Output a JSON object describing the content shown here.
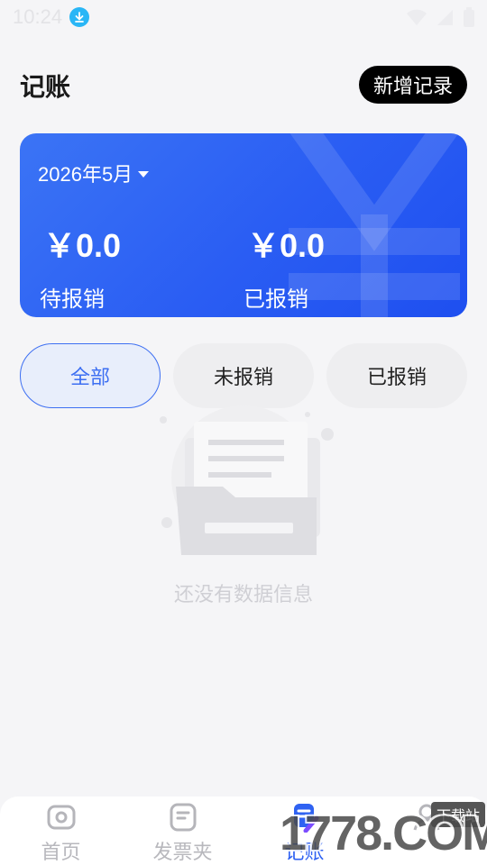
{
  "status_bar": {
    "time": "10:24"
  },
  "header": {
    "title": "记账",
    "add_button": "新增记录"
  },
  "summary": {
    "month": "2026年5月",
    "pending_amount": "￥0.0",
    "done_amount": "￥0.0",
    "pending_label": "待报销",
    "done_label": "已报销",
    "accent_color": "#2a5df3"
  },
  "filters": {
    "all": "全部",
    "pending": "未报销",
    "done": "已报销",
    "selected": "全部"
  },
  "empty_state": {
    "text": "还没有数据信息"
  },
  "tabs": [
    {
      "label": "首页",
      "icon": "camera-icon"
    },
    {
      "label": "发票夹",
      "icon": "document-icon"
    },
    {
      "label": "记账",
      "icon": "ledger-icon"
    },
    {
      "label": "",
      "icon": "user-icon"
    }
  ],
  "active_tab": "记账",
  "watermark": {
    "text": "1778.COM",
    "sub": "下载站"
  }
}
